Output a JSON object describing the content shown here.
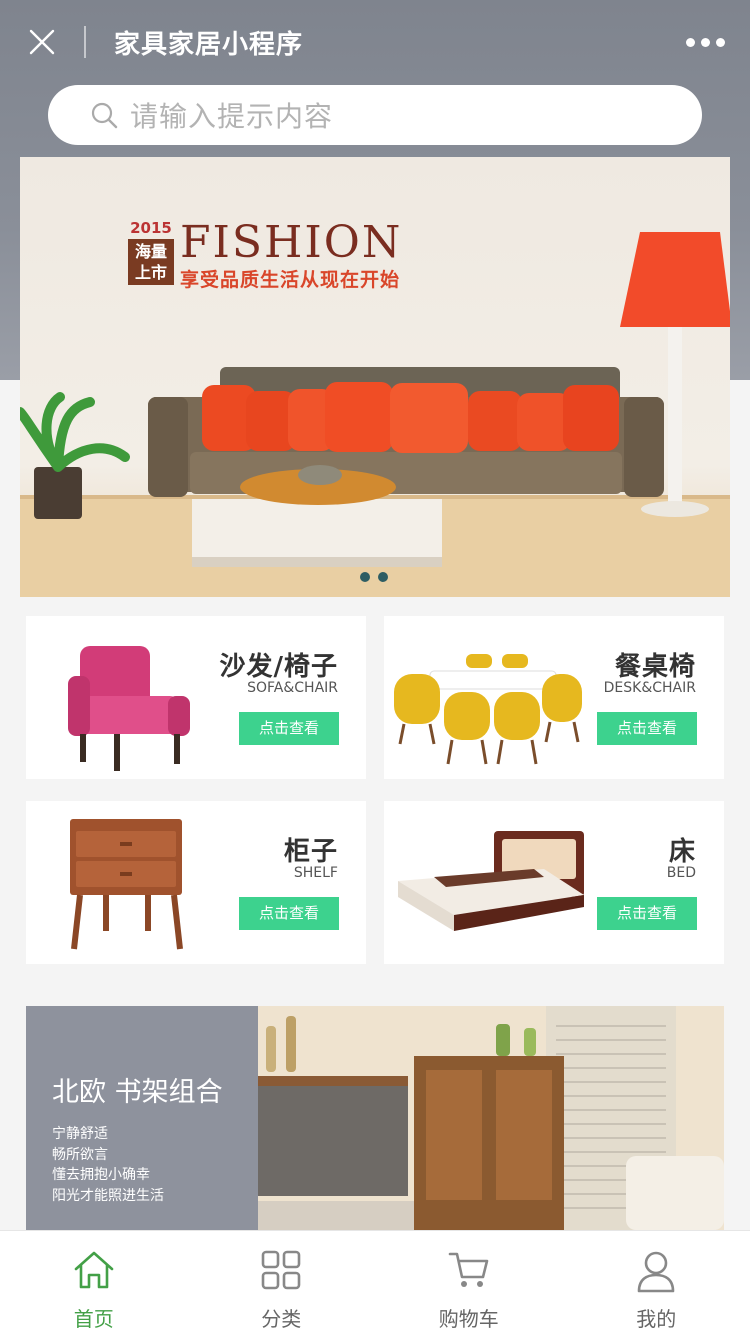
{
  "nav": {
    "title": "家具家居小程序"
  },
  "search": {
    "placeholder": "请输入提示内容"
  },
  "banner": {
    "year": "2015",
    "badge": "海量上市",
    "headline": "FISHION",
    "slogan": "享受品质生活从现在开始",
    "active_dot": 0,
    "dot_count": 2
  },
  "categories": [
    {
      "zh": "沙发/椅子",
      "en": "SOFA&CHAIR",
      "button": "点击查看"
    },
    {
      "zh": "餐桌椅",
      "en": "DESK&CHAIR",
      "button": "点击查看"
    },
    {
      "zh": "柜子",
      "en": "SHELF",
      "button": "点击查看"
    },
    {
      "zh": "床",
      "en": "BED",
      "button": "点击查看"
    }
  ],
  "promo": {
    "title": "北欧 书架组合",
    "lines": [
      "宁静舒适",
      "畅所欲言",
      "懂去拥抱小确幸",
      "阳光才能照进生活"
    ]
  },
  "tabbar": {
    "items": [
      {
        "label": "首页",
        "icon": "home-icon",
        "active": true
      },
      {
        "label": "分类",
        "icon": "grid-icon",
        "active": false
      },
      {
        "label": "购物车",
        "icon": "cart-icon",
        "active": false
      },
      {
        "label": "我的",
        "icon": "user-icon",
        "active": false
      }
    ]
  },
  "colors": {
    "accent_green": "#3dd28e",
    "tab_active": "#43a047",
    "header_gray": "#868b95"
  }
}
